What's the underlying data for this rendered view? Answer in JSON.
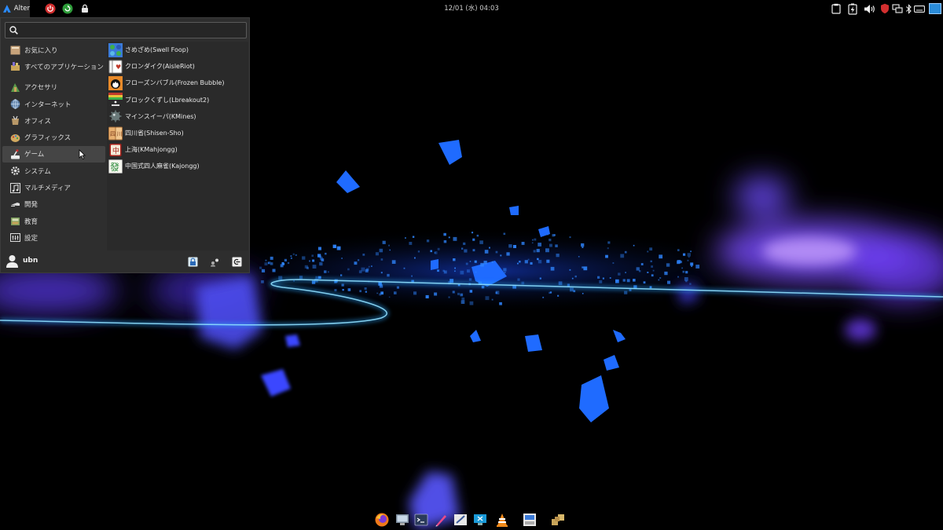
{
  "top_panel": {
    "menu_button_label": "Alter",
    "clock": "12/01 (水) 04:03",
    "left_icons": [
      "power-icon",
      "restart-icon",
      "lock-icon"
    ],
    "tray_icons": [
      "clipboard-icon",
      "battery-icon",
      "volume-icon",
      "security-icon",
      "network-icon",
      "bluetooth-icon",
      "keyboard-icon",
      "workspace-icon"
    ]
  },
  "menu": {
    "search": {
      "placeholder": "",
      "value": ""
    },
    "categories": [
      {
        "label": "お気に入り",
        "icon": "favorites-icon"
      },
      {
        "label": "すべてのアプリケーション",
        "icon": "all-apps-icon"
      },
      {
        "label": "アクセサリ",
        "icon": "accessories-icon"
      },
      {
        "label": "インターネット",
        "icon": "internet-icon"
      },
      {
        "label": "オフィス",
        "icon": "office-icon"
      },
      {
        "label": "グラフィックス",
        "icon": "graphics-icon"
      },
      {
        "label": "ゲーム",
        "icon": "games-icon",
        "selected": true
      },
      {
        "label": "システム",
        "icon": "system-icon"
      },
      {
        "label": "マルチメディア",
        "icon": "multimedia-icon"
      },
      {
        "label": "開発",
        "icon": "development-icon"
      },
      {
        "label": "教育",
        "icon": "education-icon"
      },
      {
        "label": "設定",
        "icon": "settings-icon"
      }
    ],
    "apps": [
      {
        "label": "さめざめ(Swell Foop)",
        "icon": "swell-foop-icon"
      },
      {
        "label": "クロンダイク(AisleRiot)",
        "icon": "aisleriot-icon"
      },
      {
        "label": "フローズンバブル(Frozen Bubble)",
        "icon": "frozen-bubble-icon"
      },
      {
        "label": "ブロックくずし(Lbreakout2)",
        "icon": "lbreakout-icon"
      },
      {
        "label": "マインスイーパ(KMines)",
        "icon": "kmines-icon"
      },
      {
        "label": "四川省(Shisen-Sho)",
        "icon": "shisen-sho-icon"
      },
      {
        "label": "上海(KMahjongg)",
        "icon": "kmahjongg-icon"
      },
      {
        "label": "中国式四人麻雀(Kajongg)",
        "icon": "kajongg-icon"
      }
    ],
    "user": "ubn",
    "footer_icons": [
      "lock-screen-icon",
      "switch-user-icon",
      "logout-icon"
    ]
  },
  "dock": {
    "icons": [
      "firefox-icon",
      "file-manager-icon",
      "terminal-icon",
      "text-editor-icon",
      "notes-icon",
      "remote-desktop-icon",
      "vlc-icon",
      "image-viewer-icon",
      "archive-icon"
    ]
  },
  "colors": {
    "panel_bg": "#000000",
    "menu_bg": "#2e2e2e",
    "selected_bg": "#454545",
    "accent_blue": "#1f6bff",
    "accent_purple": "#7a4dff"
  }
}
